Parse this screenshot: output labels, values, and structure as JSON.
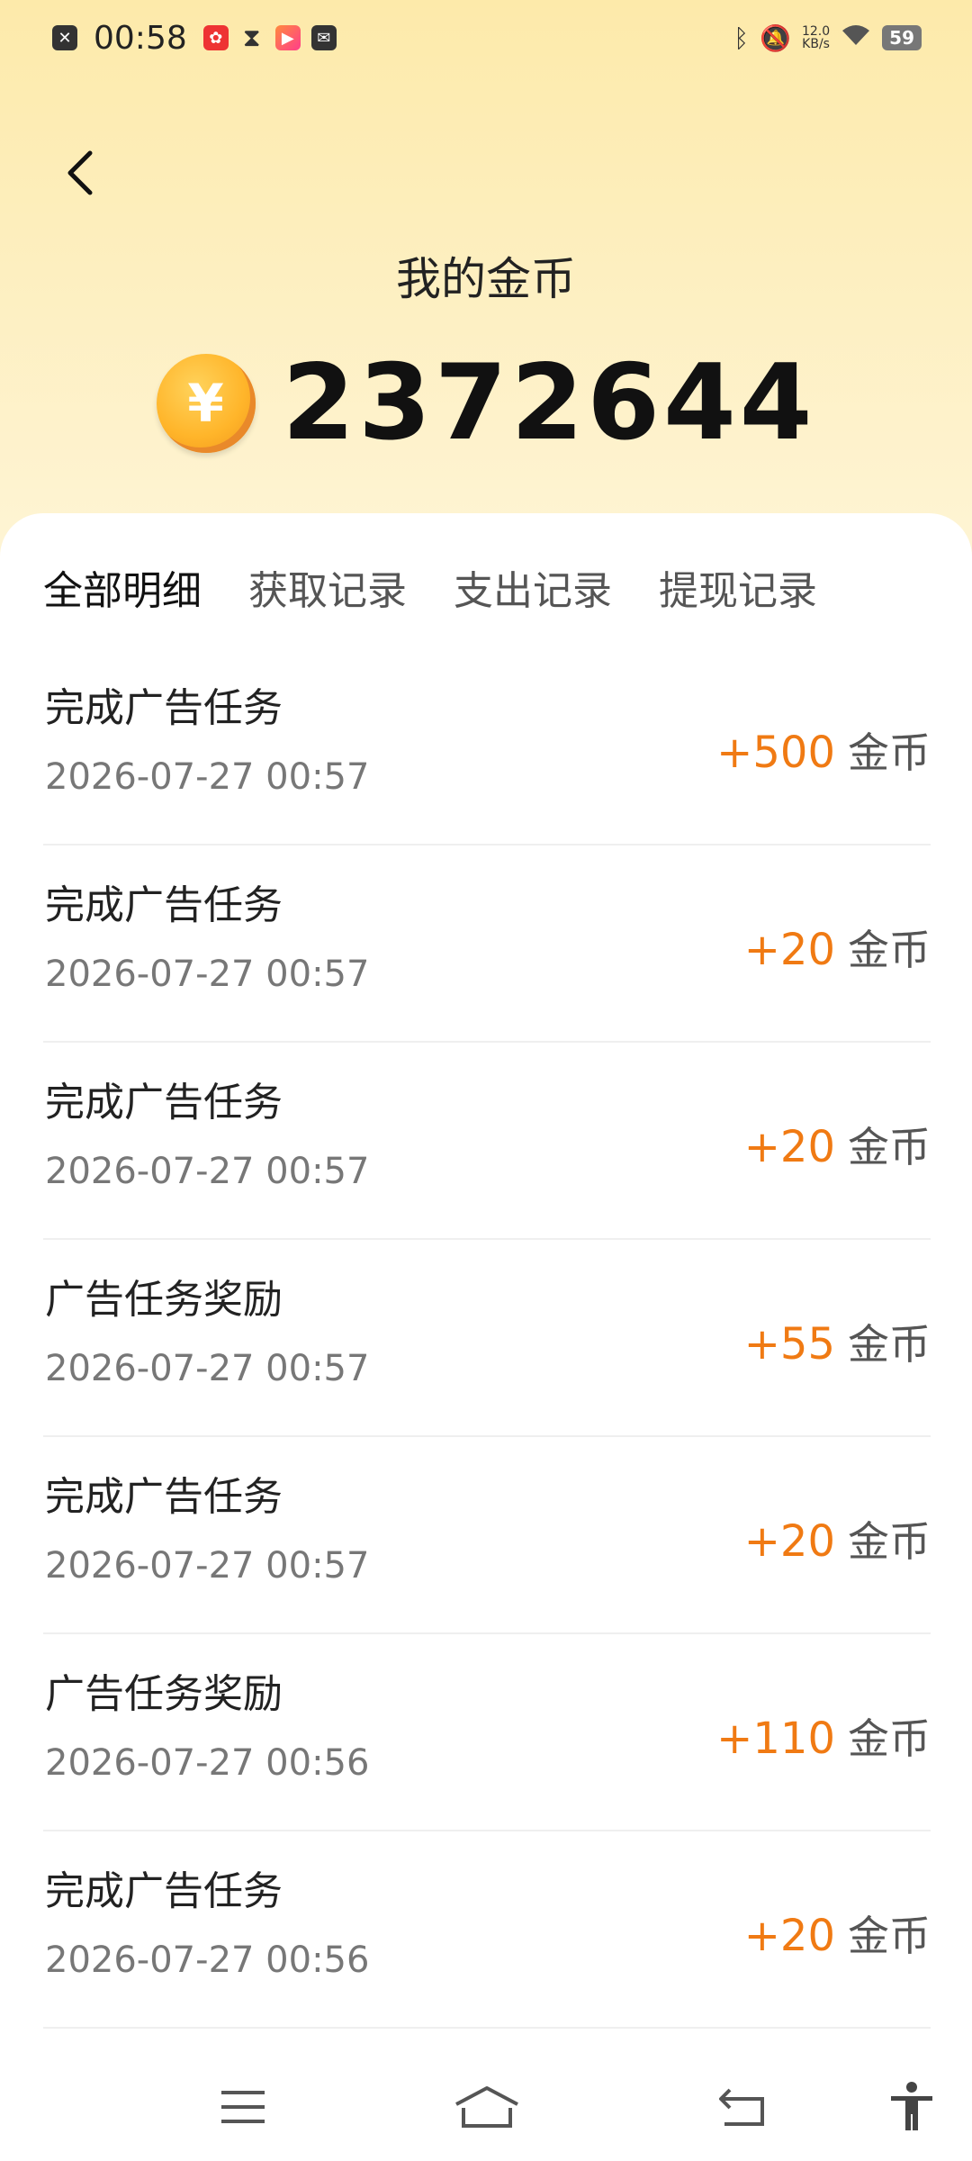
{
  "status_bar": {
    "time": "00:58",
    "network_speed_value": "12.0",
    "network_speed_unit": "KB/s",
    "battery": "59"
  },
  "header": {
    "title": "我的金币",
    "balance": "2372644"
  },
  "tabs": [
    {
      "label": "全部明细",
      "active": true
    },
    {
      "label": "获取记录",
      "active": false
    },
    {
      "label": "支出记录",
      "active": false
    },
    {
      "label": "提现记录",
      "active": false
    }
  ],
  "records": [
    {
      "title": "完成广告任务",
      "time": "2026-07-27 00:57",
      "amount": "+500",
      "unit": "金币"
    },
    {
      "title": "完成广告任务",
      "time": "2026-07-27 00:57",
      "amount": "+20",
      "unit": "金币"
    },
    {
      "title": "完成广告任务",
      "time": "2026-07-27 00:57",
      "amount": "+20",
      "unit": "金币"
    },
    {
      "title": "广告任务奖励",
      "time": "2026-07-27 00:57",
      "amount": "+55",
      "unit": "金币"
    },
    {
      "title": "完成广告任务",
      "time": "2026-07-27 00:57",
      "amount": "+20",
      "unit": "金币"
    },
    {
      "title": "广告任务奖励",
      "time": "2026-07-27 00:56",
      "amount": "+110",
      "unit": "金币"
    },
    {
      "title": "完成广告任务",
      "time": "2026-07-27 00:56",
      "amount": "+20",
      "unit": "金币"
    }
  ],
  "colors": {
    "accent_amount": "#f07a13",
    "header_bg": "#fdeaaa"
  },
  "icons": {
    "back": "back-chevron-icon",
    "coin": "coin-yen-icon",
    "nav": [
      "menu-icon",
      "home-icon",
      "back-icon",
      "accessibility-icon"
    ]
  }
}
